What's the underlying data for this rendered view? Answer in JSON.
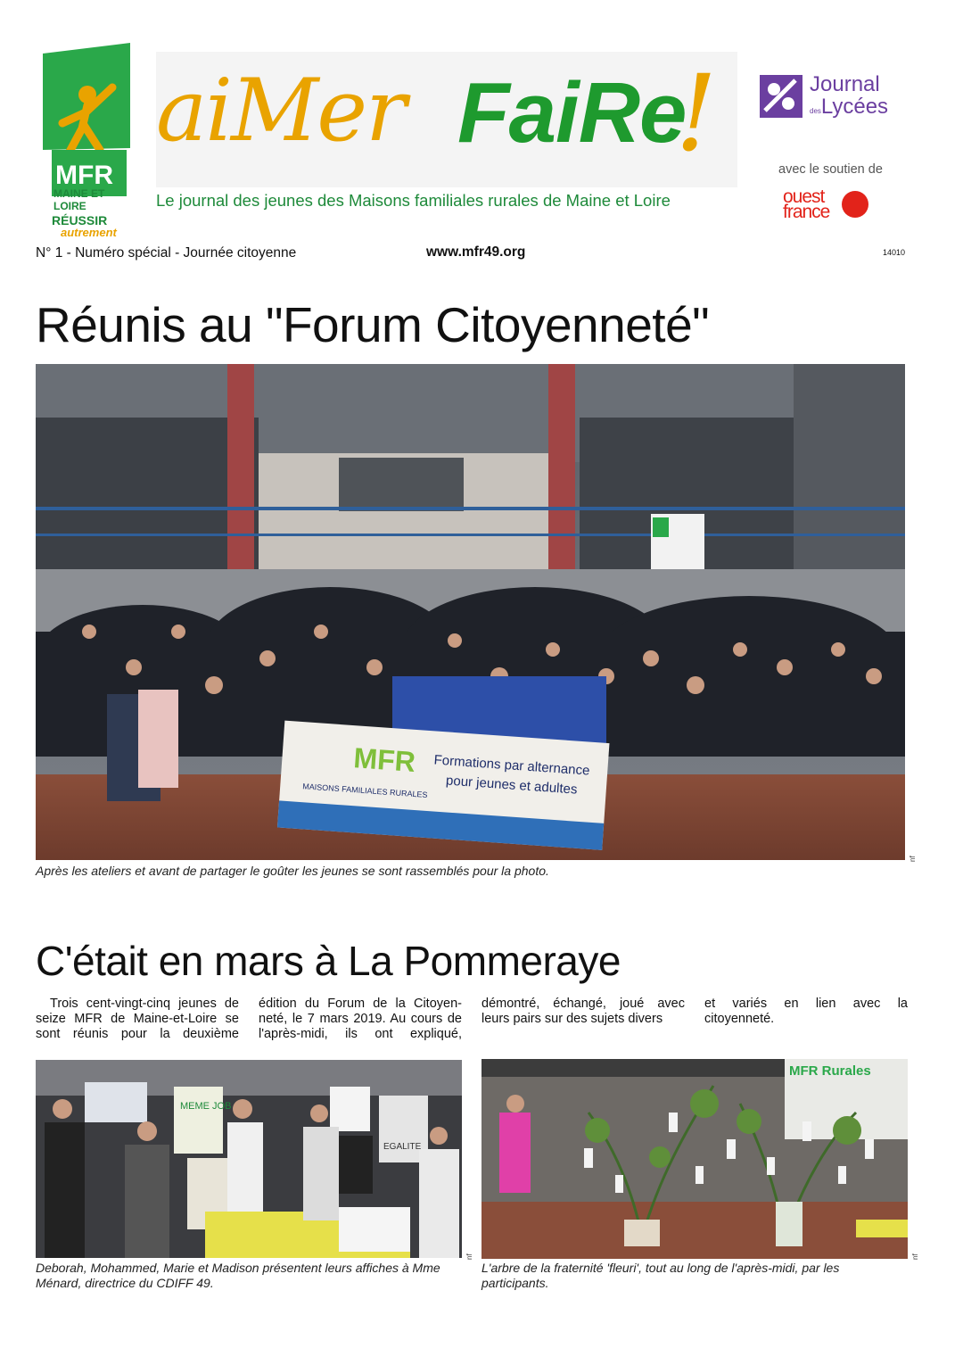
{
  "masthead": {
    "logo_mfr": "MFR",
    "logo_region": "MAINE ET LOIRE",
    "logo_slogan_1": "RÉUSSIR",
    "logo_slogan_2": "autrement",
    "title_part1": "aiMer",
    "title_part2": "FaiRe",
    "title_excl": "!",
    "subtitle": "Le journal des jeunes des Maisons familiales rurales de Maine et Loire",
    "partner_name": "Journal des Lycées",
    "partner_line1": "Journal",
    "partner_small": "des",
    "partner_line2": "Lycées",
    "support_text": "avec le soutien de",
    "sponsor_line1": "ouest",
    "sponsor_line2": "france",
    "brand_green": "#1e8a3a",
    "brand_yellow": "#e9a300",
    "partner_purple": "#6b3fa0",
    "sponsor_red": "#e2231a"
  },
  "info": {
    "issue": "N° 1 - Numéro spécial - Journée citoyenne",
    "website": "www.mfr49.org",
    "code": "14010"
  },
  "article1": {
    "headline": "Réunis au \"Forum Citoyenneté\"",
    "banner_logo": "MFR",
    "banner_text_1": "Formations par alternance",
    "banner_text_2": "pour jeunes et adultes",
    "banner_org": "MAISONS FAMILIALES RURALES",
    "photo_credit": "nf",
    "caption": "Après les ateliers et avant de partager le goûter les jeunes se sont rassemblés pour la photo."
  },
  "article2": {
    "headline": "C'était en mars à La Pommeraye",
    "columns": [
      "Trois cent-vingt-cinq jeunes de seize MFR de Maine-et-Loire se sont réunis pour la deuxième édition du Forum de la Citoyenneté",
      "édition du Forum de la Citoyen-neté, le 7 mars 2019. Au cours de l'après-midi, ils ont expliqué, démontré",
      "démontré, échangé, joué avec leurs pairs sur des sujets divers",
      "et variés en lien avec la citoyenneté."
    ],
    "photo_left_credit": "nf",
    "photo_left_caption": "Deborah, Mohammed, Marie et Madison présentent leurs affiches à Mme Ménard, directrice du CDIFF 49.",
    "poster_text": "MEME JOB",
    "poster_text_2": "EGALITE",
    "photo_right_credit": "nf",
    "photo_right_caption": "L'arbre de la fraternité 'fleuri', tout au long de l'après-midi, par les participants.",
    "sign_text": "MFR Rurales"
  }
}
